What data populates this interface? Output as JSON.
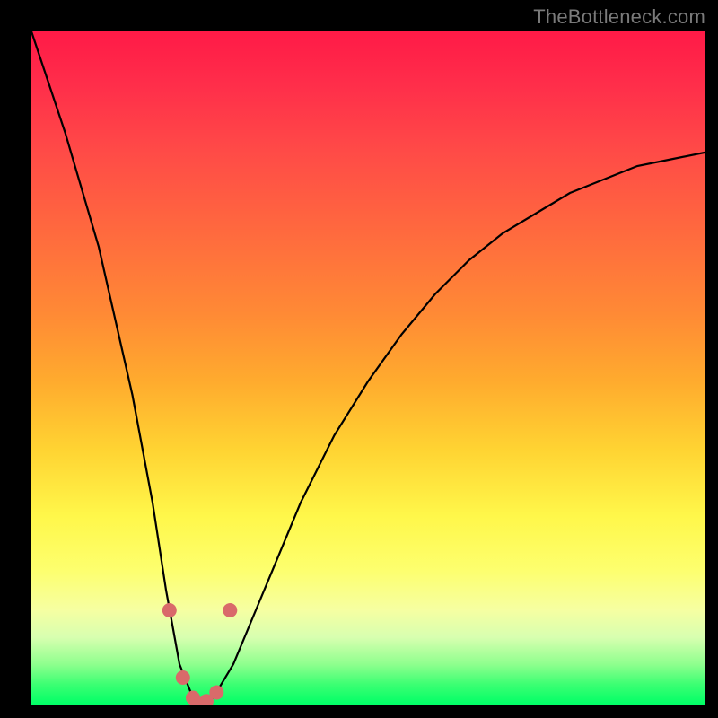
{
  "watermark": "TheBottleneck.com",
  "chart_data": {
    "type": "line",
    "title": "",
    "xlabel": "",
    "ylabel": "",
    "xlim": [
      0,
      100
    ],
    "ylim": [
      0,
      100
    ],
    "series": [
      {
        "name": "bottleneck-curve",
        "x": [
          0,
          5,
          10,
          15,
          18,
          20,
          22,
          24,
          25,
          27,
          30,
          35,
          40,
          45,
          50,
          55,
          60,
          65,
          70,
          75,
          80,
          85,
          90,
          95,
          100
        ],
        "values": [
          100,
          85,
          68,
          46,
          30,
          17,
          6,
          1,
          0,
          1,
          6,
          18,
          30,
          40,
          48,
          55,
          61,
          66,
          70,
          73,
          76,
          78,
          80,
          81,
          82
        ]
      }
    ],
    "markers": {
      "name": "highlight-points",
      "color": "#d96a6a",
      "x": [
        20.5,
        22.5,
        24.0,
        25.0,
        26.0,
        27.5,
        29.5
      ],
      "values": [
        14.0,
        4.0,
        1.0,
        0.0,
        0.5,
        1.8,
        14.0
      ]
    },
    "background": {
      "kind": "vertical-gradient",
      "stops": [
        {
          "pos": 0,
          "color": "#ff1a47"
        },
        {
          "pos": 50,
          "color": "#ffab2e"
        },
        {
          "pos": 75,
          "color": "#fff74a"
        },
        {
          "pos": 92,
          "color": "#8fff8e"
        },
        {
          "pos": 100,
          "color": "#00ff66"
        }
      ]
    }
  }
}
